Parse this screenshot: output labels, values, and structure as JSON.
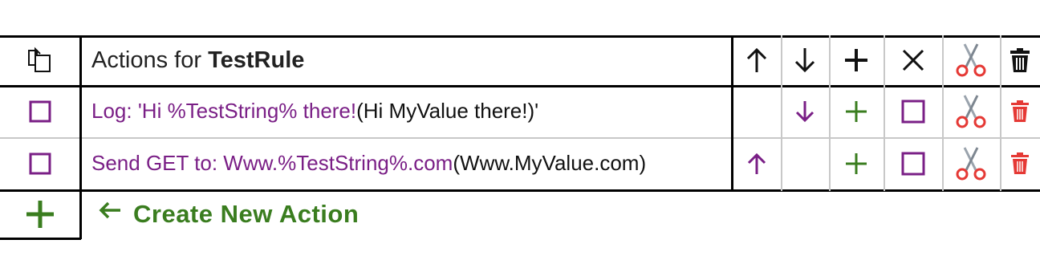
{
  "header": {
    "title_prefix": "Actions for ",
    "rule_name": "TestRule"
  },
  "actions": [
    {
      "template": "Log: 'Hi %TestString% there!",
      "resolved": "(Hi MyValue there!)'"
    },
    {
      "template": "Send GET to: Www.%TestString%.com",
      "resolved": "(Www.MyValue.com)"
    }
  ],
  "footer": {
    "create_label": "Create New Action"
  },
  "colors": {
    "purple": "#7a1f86",
    "green": "#3a7d1f",
    "red": "#e53935",
    "border": "#000000",
    "grid": "#c8c8c8"
  },
  "icons": {
    "header": [
      "copy-icon",
      "arrow-up-icon",
      "arrow-down-icon",
      "plus-icon",
      "close-icon",
      "scissors-icon",
      "trash-icon"
    ],
    "rows": [
      "checkbox-icon",
      "arrow-up-icon",
      "arrow-down-icon",
      "plus-icon",
      "checkbox-icon",
      "scissors-icon",
      "trash-icon"
    ]
  }
}
